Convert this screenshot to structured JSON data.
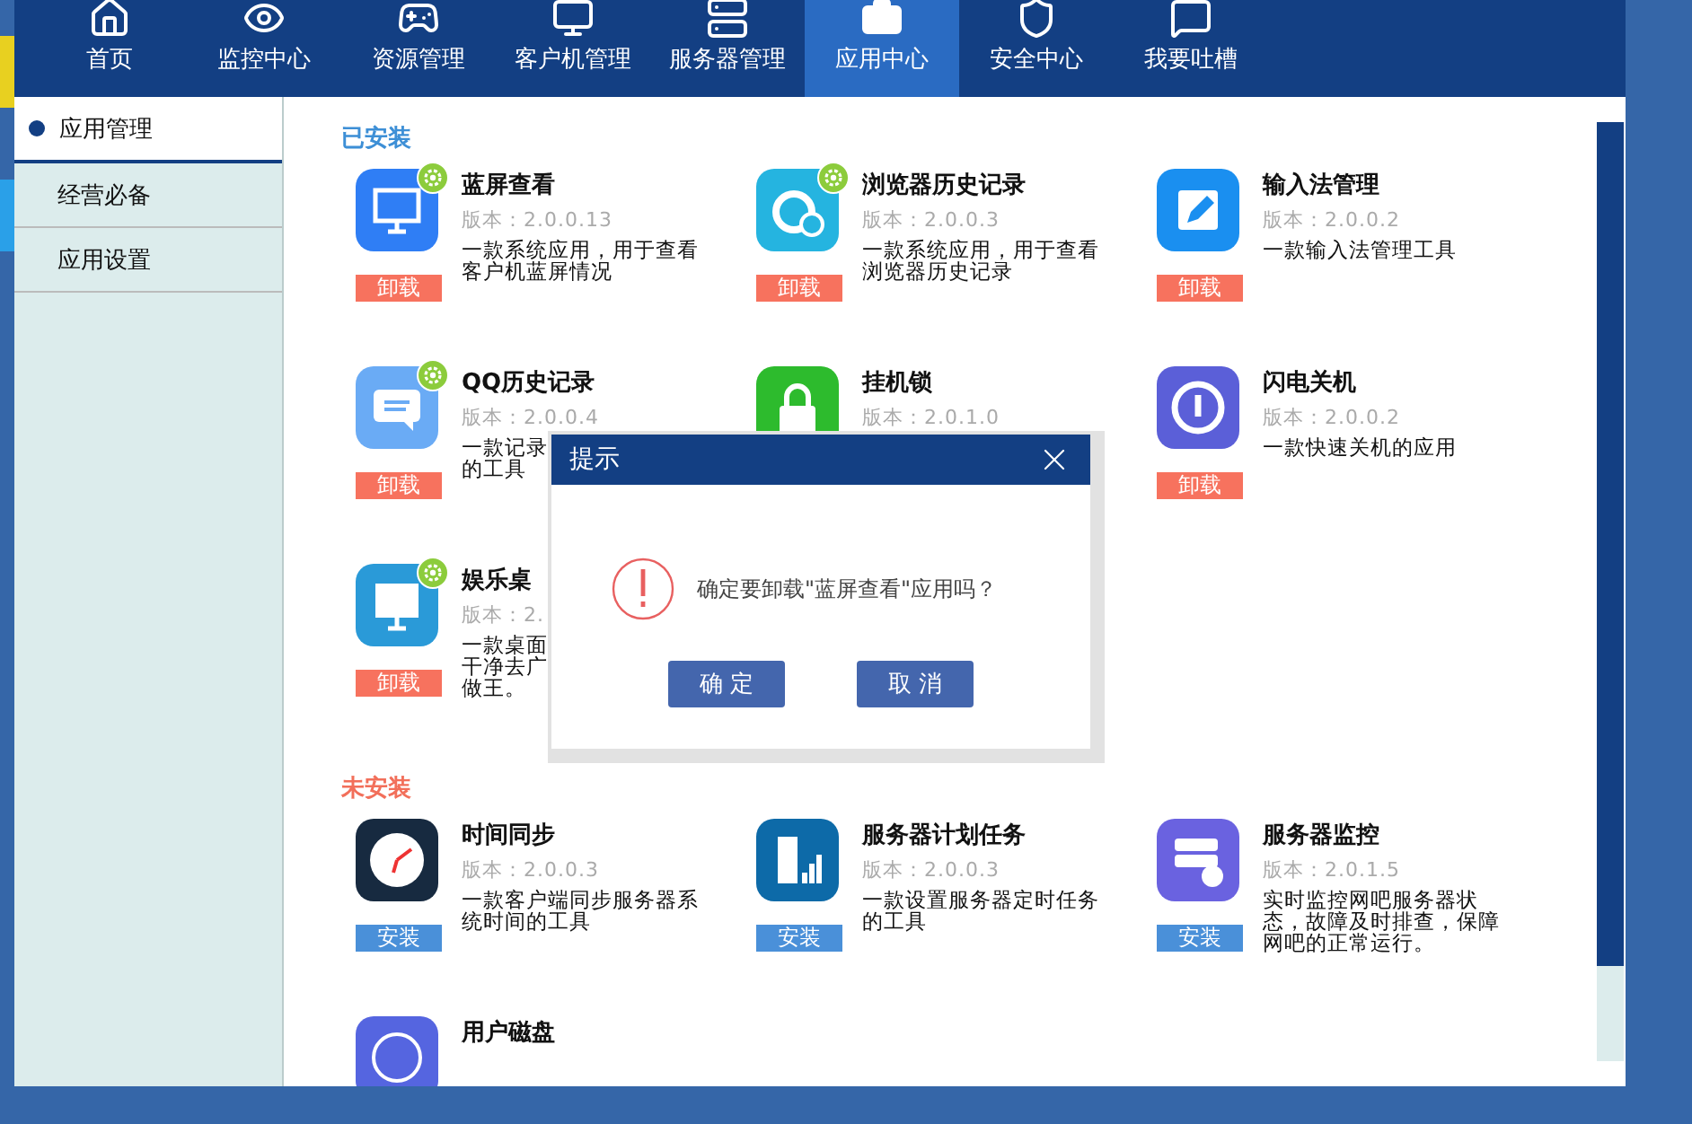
{
  "nav": [
    {
      "label": "首页",
      "selected": false
    },
    {
      "label": "监控中心",
      "selected": false
    },
    {
      "label": "资源管理",
      "selected": false
    },
    {
      "label": "客户机管理",
      "selected": false
    },
    {
      "label": "服务器管理",
      "selected": false
    },
    {
      "label": "应用中心",
      "selected": true
    },
    {
      "label": "安全中心",
      "selected": false
    },
    {
      "label": "我要吐槽",
      "selected": false
    }
  ],
  "sidebar": {
    "items": [
      {
        "label": "应用管理",
        "selected": true
      },
      {
        "label": "经营必备",
        "selected": false
      },
      {
        "label": "应用设置",
        "selected": false
      }
    ]
  },
  "sections": [
    {
      "title": "已安装",
      "kind": "installed",
      "apps": [
        {
          "name": "蓝屏查看",
          "version": "版本：2.0.0.13",
          "description": "一款系统应用，用于查看客户机蓝屏情况",
          "badge": true,
          "button": "卸载"
        },
        {
          "name": "浏览器历史记录",
          "version": "版本：2.0.0.3",
          "description": "一款系统应用，用于查看浏览器历史记录",
          "badge": true,
          "button": "卸载"
        },
        {
          "name": "输入法管理",
          "version": "版本：2.0.0.2",
          "description": "一款输入法管理工具",
          "badge": false,
          "button": "卸载"
        },
        {
          "name": "QQ历史记录",
          "version": "版本：2.0.0.4",
          "description_lines": [
            "一款记录",
            "的工具"
          ],
          "badge": true,
          "button": "卸载"
        },
        {
          "name": "挂机锁",
          "version": "版本：2.0.1.0",
          "badge": false
        },
        {
          "name": "闪电关机",
          "version": "版本：2.0.0.2",
          "description": "一款快速关机的应用",
          "badge": false,
          "button": "卸载"
        },
        {
          "name": "娱乐桌",
          "version": "版本：2.",
          "description_lines": [
            "一款桌面",
            "干净去广",
            "做王。"
          ],
          "badge": true,
          "button": "卸载"
        }
      ]
    },
    {
      "title": "未安装",
      "kind": "available",
      "apps": [
        {
          "name": "时间同步",
          "version": "版本：2.0.0.3",
          "description": "一款客户端同步服务器系统时间的工具",
          "badge": false,
          "button": "安装"
        },
        {
          "name": "服务器计划任务",
          "version": "版本：2.0.0.3",
          "description": "一款设置服务器定时任务的工具",
          "badge": false,
          "button": "安装"
        },
        {
          "name": "服务器监控",
          "version": "版本：2.0.1.5",
          "description": "实时监控网吧服务器状态，故障及时排查，保障网吧的正常运行。",
          "badge": false,
          "button": "安装"
        },
        {
          "name": "用户磁盘",
          "badge": false
        }
      ]
    }
  ],
  "dialog": {
    "title": "提示",
    "message": "确定要卸载\"蓝屏查看\"应用吗？",
    "buttons": [
      "确 定",
      "取 消"
    ]
  }
}
